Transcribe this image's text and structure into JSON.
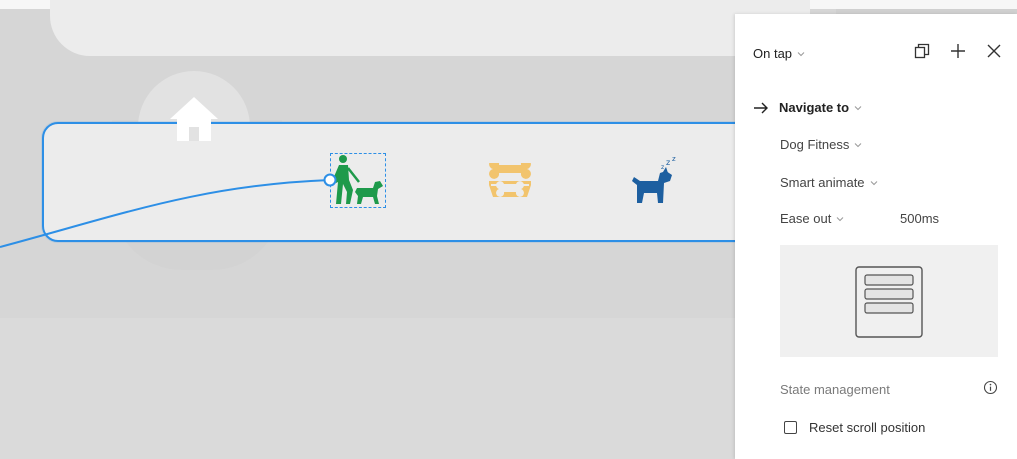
{
  "canvas": {
    "nav_icons": [
      "home-icon",
      "dog-walking-icon",
      "bone-bowl-icon",
      "sleeping-dog-icon"
    ],
    "colors": {
      "wire": "#2d8fe6",
      "active_icon": "#1e9a4b",
      "bowl_icon": "#f2c46d",
      "sleep_dog": "#1d5fa0"
    }
  },
  "panel": {
    "trigger": "On tap",
    "action": "Navigate to",
    "destination": "Dog Fitness",
    "animation": "Smart animate",
    "easing": "Ease out",
    "duration": "500ms",
    "state_label": "State management",
    "reset_scroll_label": "Reset scroll position",
    "reset_scroll_checked": false,
    "header_icons": [
      "duplicate-icon",
      "plus-icon",
      "close-icon"
    ]
  }
}
